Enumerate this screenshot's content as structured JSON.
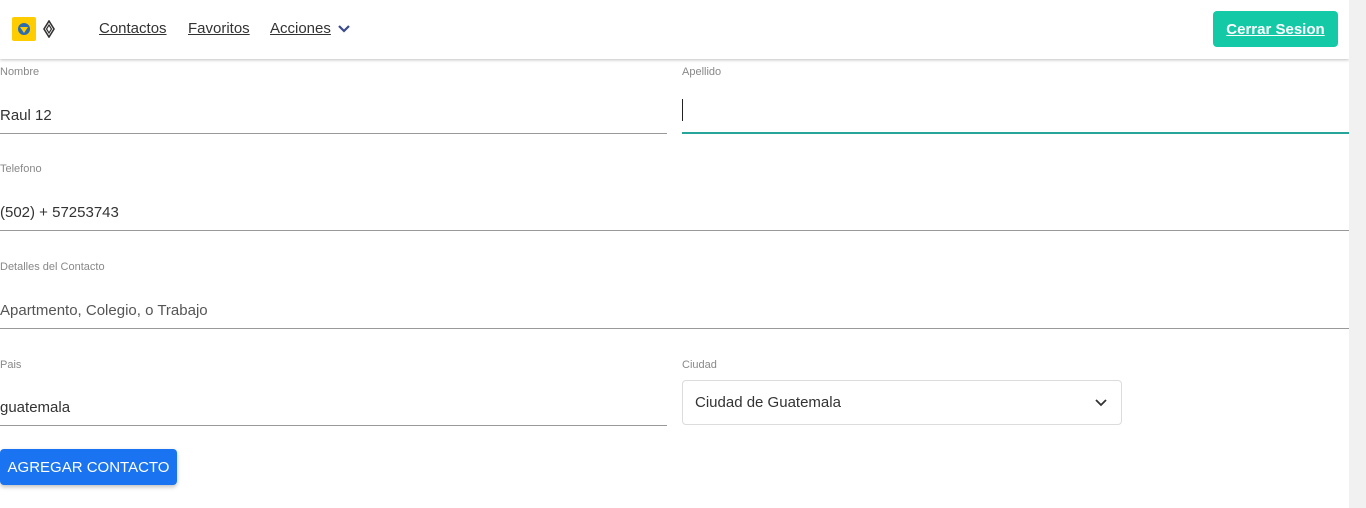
{
  "nav": {
    "links": [
      "Contactos",
      "Favoritos",
      "Acciones"
    ],
    "logout_label": "Cerrar Sesion",
    "logo_color": "#ffcc00",
    "dropdown_icon": "chevron-down-icon"
  },
  "form": {
    "nombre": {
      "label": "Nombre",
      "value": "Raul 12"
    },
    "apellido": {
      "label": "Apellido",
      "value": ""
    },
    "telefono": {
      "label": "Telefono",
      "value": "(502) + 57253743"
    },
    "detalles": {
      "label": "Detalles del Contacto",
      "placeholder": "Apartmento, Colegio, o Trabajo"
    },
    "pais": {
      "label": "Pais",
      "value": "guatemala"
    },
    "ciudad": {
      "label": "Ciudad",
      "selected": "Ciudad de Guatemala"
    },
    "submit_label": "AGREGAR CONTACTO"
  },
  "colors": {
    "accent": "#13c9a6",
    "primary_button": "#1a73f0",
    "focus_underline": "#26a69a"
  }
}
